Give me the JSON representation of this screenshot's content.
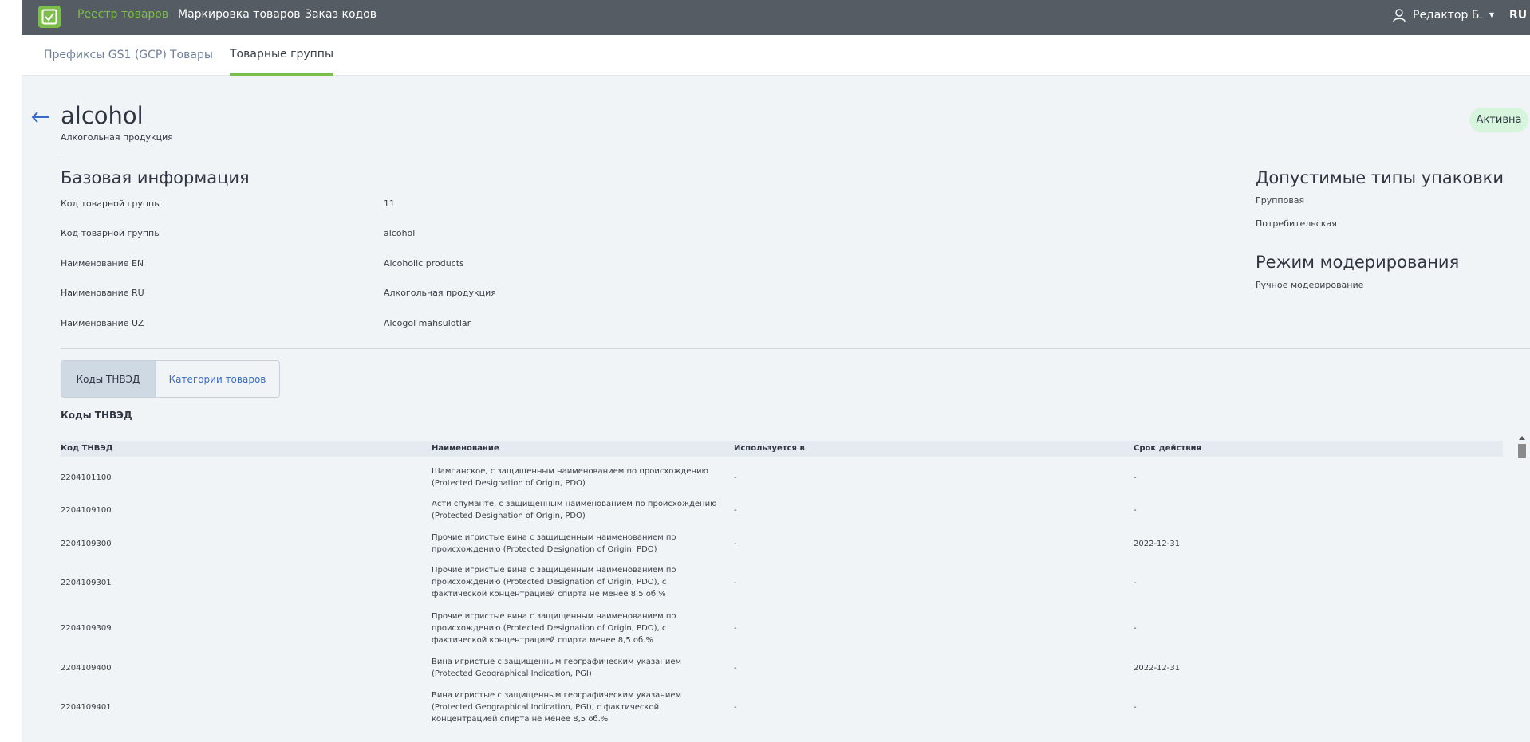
{
  "nav": {
    "items": [
      {
        "label": "Реестр товаров",
        "active": true
      },
      {
        "label": "Маркировка товаров",
        "active": false
      },
      {
        "label": "Заказ кодов",
        "active": false
      }
    ],
    "user": "Редактор Б.",
    "lang": "RU"
  },
  "subnav": {
    "tabs": [
      {
        "label": "Префиксы GS1 (GCP)",
        "active": false
      },
      {
        "label": "Товары",
        "active": false
      },
      {
        "label": "Товарные группы",
        "active": true
      }
    ]
  },
  "page": {
    "title": "alcohol",
    "subtitle": "Алкогольная продукция",
    "status": "Активна"
  },
  "basic_info": {
    "title": "Базовая информация",
    "rows": [
      {
        "label": "Код товарной группы",
        "value": "11"
      },
      {
        "label": "Код товарной группы",
        "value": "alcohol"
      },
      {
        "label": "Наименование EN",
        "value": "Alcoholic products"
      },
      {
        "label": "Наименование RU",
        "value": "Алкогольная продукция"
      },
      {
        "label": "Наименование UZ",
        "value": "Alcogol mahsulotlar"
      }
    ]
  },
  "packaging": {
    "title": "Допустимые типы упаковки",
    "items": [
      "Групповая",
      "Потребительская"
    ]
  },
  "moderation": {
    "title": "Режим модерирования",
    "value": "Ручное модерирование"
  },
  "tabs": [
    {
      "label": "Коды ТНВЭД",
      "active": true
    },
    {
      "label": "Категории товаров",
      "active": false
    }
  ],
  "table": {
    "title": "Коды ТНВЭД",
    "headers": [
      "Код ТНВЭД",
      "Наименование",
      "Используется в",
      "Срок действия"
    ],
    "rows": [
      {
        "code": "2204101100",
        "name": "Шампанское, с защищенным наименованием по происхождению (Protected Designation of Origin, PDO)",
        "used": "-",
        "expiry": "-"
      },
      {
        "code": "2204109100",
        "name": "Асти спуманте, с защищенным наименованием по происхождению (Protected Designation of Origin, PDO)",
        "used": "-",
        "expiry": "-"
      },
      {
        "code": "2204109300",
        "name": "Прочие игристые вина с защищенным наименованием по происхождению (Protected Designation of Origin, PDO)",
        "used": "-",
        "expiry": "2022-12-31"
      },
      {
        "code": "2204109301",
        "name": "Прочие игристые вина с защищенным наименованием по происхождению (Protected Designation of Origin, PDO), с фактической концентрацией спирта не менее 8,5 об.%",
        "used": "-",
        "expiry": "-"
      },
      {
        "code": "2204109309",
        "name": "Прочие игристые вина с защищенным наименованием по происхождению (Protected Designation of Origin, PDO), с фактической концентрацией спирта менее 8,5 об.%",
        "used": "-",
        "expiry": "-"
      },
      {
        "code": "2204109400",
        "name": "Вина игристые с защищенным географическим указанием (Protected Geographical Indication, PGI)",
        "used": "-",
        "expiry": "2022-12-31"
      },
      {
        "code": "2204109401",
        "name": "Вина игристые с защищенным географическим указанием (Protected Geographical Indication, PGI), с фактической концентрацией спирта не менее 8,5 об.%",
        "used": "-",
        "expiry": "-"
      }
    ]
  },
  "colors": {
    "accent": "#7dbd4a",
    "header": "#565c64",
    "link": "#3a6cc5",
    "badge": "#d6f5dc"
  }
}
